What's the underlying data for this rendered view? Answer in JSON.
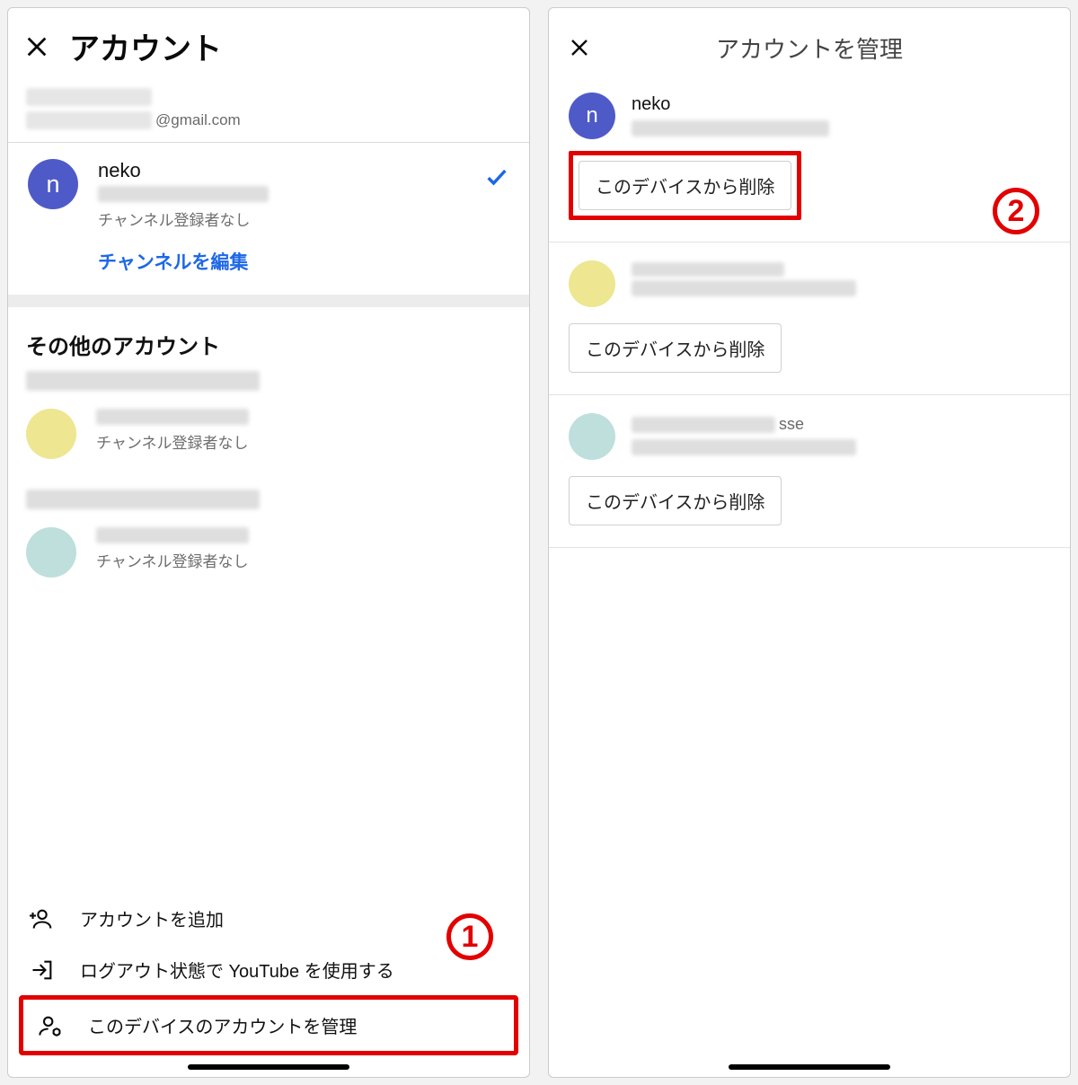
{
  "left": {
    "title": "アカウント",
    "email_suffix": "@gmail.com",
    "current": {
      "avatar_letter": "n",
      "name": "neko",
      "subscribers": "チャンネル登録者なし",
      "edit_link": "チャンネルを編集"
    },
    "other_header": "その他のアカウント",
    "others": [
      {
        "subscribers": "チャンネル登録者なし"
      },
      {
        "subscribers": "チャンネル登録者なし"
      }
    ],
    "footer": {
      "add": "アカウントを追加",
      "logout": "ログアウト状態で YouTube を使用する",
      "manage": "このデバイスのアカウントを管理"
    },
    "callout": "1"
  },
  "right": {
    "title": "アカウントを管理",
    "accounts": [
      {
        "avatar_letter": "n",
        "name": "neko",
        "color": "blue",
        "delete_label": "このデバイスから削除"
      },
      {
        "color": "yellow",
        "delete_label": "このデバイスから削除"
      },
      {
        "color": "mint",
        "suffix": "sse",
        "delete_label": "このデバイスから削除"
      }
    ],
    "callout": "2"
  }
}
